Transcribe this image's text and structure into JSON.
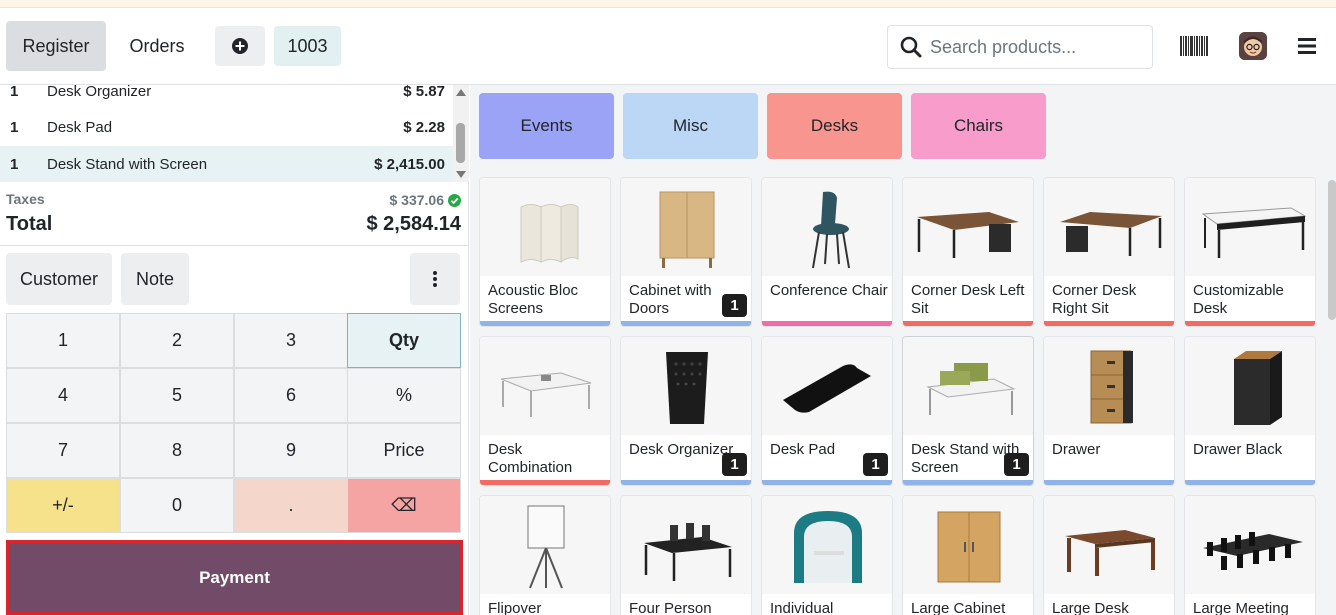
{
  "navbar": {
    "register_label": "Register",
    "orders_label": "Orders",
    "order_number": "1003",
    "search_placeholder": "Search products..."
  },
  "orderlines": [
    {
      "qty": "1",
      "name": "Desk Organizer",
      "price": "$ 5.87"
    },
    {
      "qty": "1",
      "name": "Desk Pad",
      "price": "$ 2.28"
    },
    {
      "qty": "1",
      "name": "Desk Stand with Screen",
      "price": "$ 2,415.00"
    }
  ],
  "summary": {
    "taxes_label": "Taxes",
    "taxes_value": "$ 337.06",
    "total_label": "Total",
    "total_value": "$ 2,584.14"
  },
  "controls": {
    "customer_label": "Customer",
    "note_label": "Note"
  },
  "numpad": {
    "keys": [
      "1",
      "2",
      "3",
      "Qty",
      "4",
      "5",
      "6",
      "%",
      "7",
      "8",
      "9",
      "Price",
      "+/-",
      "0",
      ".",
      "⌫"
    ]
  },
  "payment_label": "Payment",
  "categories": [
    {
      "label": "Events",
      "color": "#9ba3f7"
    },
    {
      "label": "Misc",
      "color": "#bcd7f5"
    },
    {
      "label": "Desks",
      "color": "#f7958e"
    },
    {
      "label": "Chairs",
      "color": "#f79ccb"
    }
  ],
  "products": [
    {
      "name": "Acoustic Bloc Screens",
      "badge": "",
      "bar_color": "#8fb3e8"
    },
    {
      "name": "Cabinet with Doors",
      "badge": "1",
      "bar_color": "#8fb3e8"
    },
    {
      "name": "Conference Chair",
      "badge": "",
      "bar_color": "#ef6ea7"
    },
    {
      "name": "Corner Desk Left Sit",
      "badge": "",
      "bar_color": "#ef6b63"
    },
    {
      "name": "Corner Desk Right Sit",
      "badge": "",
      "bar_color": "#ef6b63"
    },
    {
      "name": "Customizable Desk",
      "badge": "",
      "bar_color": "#ef6b63"
    },
    {
      "name": "Desk Combination",
      "badge": "",
      "bar_color": "#ef6b63"
    },
    {
      "name": "Desk Organizer",
      "badge": "1",
      "bar_color": "#8fb3e8"
    },
    {
      "name": "Desk Pad",
      "badge": "1",
      "bar_color": "#8fb3e8"
    },
    {
      "name": "Desk Stand with Screen",
      "badge": "1",
      "bar_color": "#8fb3e8"
    },
    {
      "name": "Drawer",
      "badge": "",
      "bar_color": "#8fb3e8"
    },
    {
      "name": "Drawer Black",
      "badge": "",
      "bar_color": "#8fb3e8"
    },
    {
      "name": "Flipover",
      "badge": "",
      "bar_color": "#8fb3e8"
    },
    {
      "name": "Four Person",
      "badge": "",
      "bar_color": "#8fb3e8"
    },
    {
      "name": "Individual",
      "badge": "",
      "bar_color": "#8fb3e8"
    },
    {
      "name": "Large Cabinet",
      "badge": "",
      "bar_color": "#8fb3e8"
    },
    {
      "name": "Large Desk",
      "badge": "",
      "bar_color": "#8fb3e8"
    },
    {
      "name": "Large Meeting",
      "badge": "",
      "bar_color": "#8fb3e8"
    }
  ]
}
